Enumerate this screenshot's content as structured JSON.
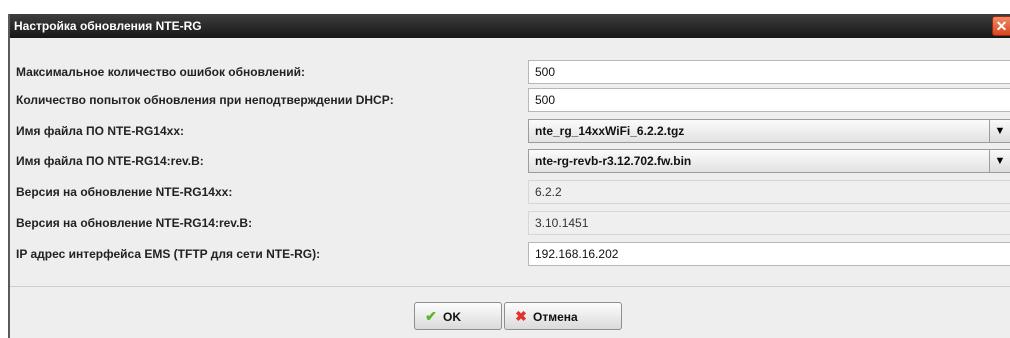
{
  "window": {
    "title": "Настройка обновления NTE-RG",
    "close_glyph": "✕"
  },
  "rows": [
    {
      "label": "Максимальное количество ошибок обновлений:",
      "value": "500",
      "kind": "editable"
    },
    {
      "label": "Количество попыток обновления при неподтверждении DHCP:",
      "value": "500",
      "kind": "editable"
    },
    {
      "label": "Имя файла ПО NTE-RG14xx:",
      "value": "nte_rg_14xxWiFi_6.2.2.tgz",
      "kind": "combo"
    },
    {
      "label": "Имя файла ПО NTE-RG14:rev.B:",
      "value": "nte-rg-revb-r3.12.702.fw.bin",
      "kind": "combo"
    },
    {
      "label": "Версия на обновление NTE-RG14xx:",
      "value": "6.2.2",
      "kind": "readonly"
    },
    {
      "label": "Версия на обновление NTE-RG14:rev.B:",
      "value": "3.10.1451",
      "kind": "readonly"
    },
    {
      "label": "IP адрес интерфейса EMS (TFTP для сети NTE-RG):",
      "value": "192.168.16.202",
      "kind": "editable"
    }
  ],
  "combo_arrow": "▼",
  "buttons": {
    "ok": {
      "label": "OK",
      "icon": "checkmark-icon",
      "glyph": "✔"
    },
    "cancel": {
      "label": "Отмена",
      "icon": "red-x-icon",
      "glyph": "✖"
    }
  },
  "colors": {
    "titlebar": "#2a2a2a",
    "close": "#d9461f",
    "ok_icon": "#5bb52a",
    "cancel_icon": "#e0342a"
  }
}
